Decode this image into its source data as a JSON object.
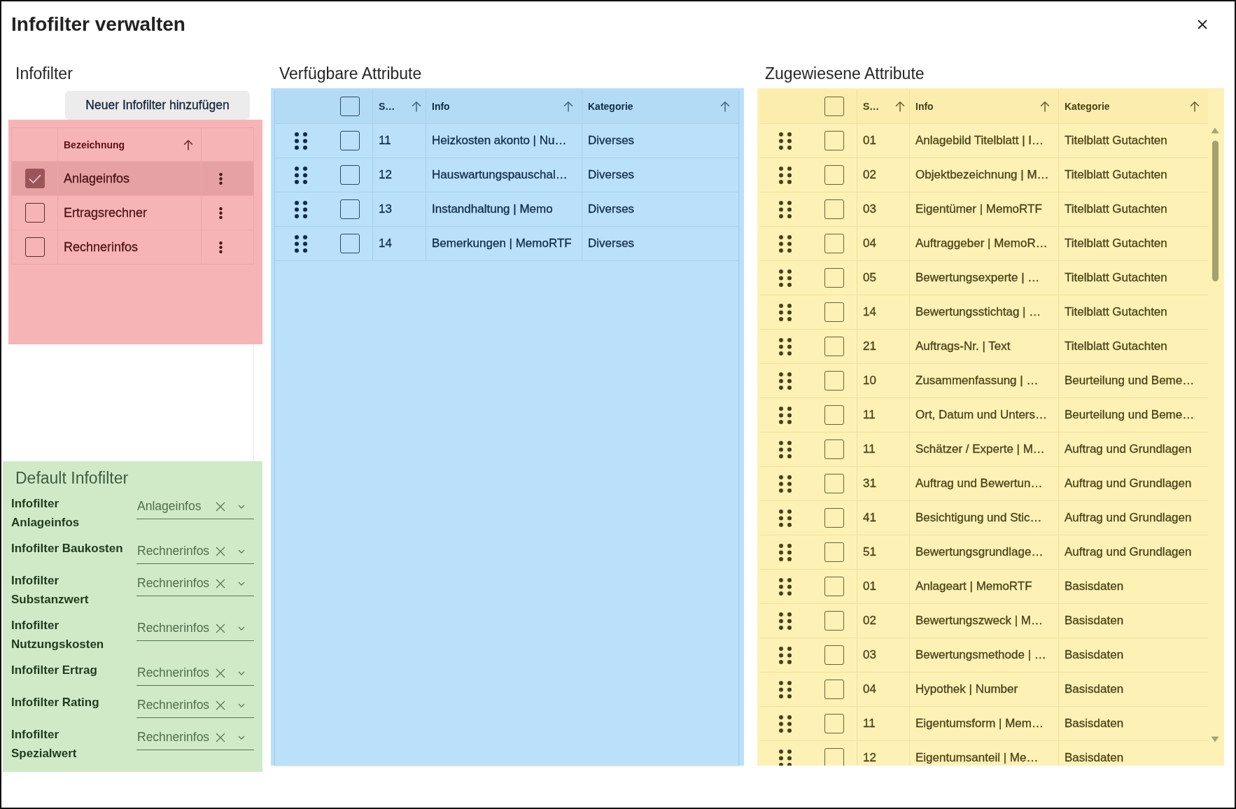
{
  "window": {
    "title": "Infofilter verwalten"
  },
  "infofilter": {
    "heading": "Infofilter",
    "add_button": "Neuer Infofilter hinzufügen",
    "columns": [
      {
        "label": "Bezeichnung",
        "sorted": true
      }
    ],
    "rows": [
      {
        "name": "Anlageinfos",
        "checked": true,
        "selected": true
      },
      {
        "name": "Ertragsrechner",
        "checked": false,
        "selected": false
      },
      {
        "name": "Rechnerinfos",
        "checked": false,
        "selected": false
      }
    ]
  },
  "default_infofilter": {
    "heading": "Default Infofilter",
    "fields": [
      {
        "label": "Infofilter Anlageinfos",
        "value": "Anlageinfos"
      },
      {
        "label": "Infofilter Baukosten",
        "value": "Rechnerinfos"
      },
      {
        "label": "Infofilter Substanzwert",
        "value": "Rechnerinfos"
      },
      {
        "label": "Infofilter Nutzungskosten",
        "value": "Rechnerinfos"
      },
      {
        "label": "Infofilter Ertrag",
        "value": "Rechnerinfos"
      },
      {
        "label": "Infofilter Rating",
        "value": "Rechnerinfos"
      },
      {
        "label": "Infofilter Spezialwert",
        "value": "Rechnerinfos"
      }
    ]
  },
  "available_attributes": {
    "heading": "Verfügbare Attribute",
    "header_checked": false,
    "columns": [
      {
        "label": "S…",
        "sorted": true
      },
      {
        "label": "Info",
        "sorted": true
      },
      {
        "label": "Kategorie",
        "sorted": true
      }
    ],
    "rows": [
      {
        "s": "11",
        "info": "Heizkosten akonto | Nu…",
        "kategorie": "Diverses",
        "checked": false
      },
      {
        "s": "12",
        "info": "Hauswartungspauschal…",
        "kategorie": "Diverses",
        "checked": false
      },
      {
        "s": "13",
        "info": "Instandhaltung | Memo",
        "kategorie": "Diverses",
        "checked": false
      },
      {
        "s": "14",
        "info": "Bemerkungen | MemoRTF",
        "kategorie": "Diverses",
        "checked": false
      }
    ]
  },
  "assigned_attributes": {
    "heading": "Zugewiesene Attribute",
    "header_checked": false,
    "columns": [
      {
        "label": "S…",
        "sorted": true
      },
      {
        "label": "Info",
        "sorted": true
      },
      {
        "label": "Kategorie",
        "sorted": true
      }
    ],
    "rows": [
      {
        "s": "01",
        "info": "Anlagebild Titelblatt | I…",
        "kategorie": "Titelblatt Gutachten",
        "checked": false
      },
      {
        "s": "02",
        "info": "Objektbezeichnung | M…",
        "kategorie": "Titelblatt Gutachten",
        "checked": false
      },
      {
        "s": "03",
        "info": "Eigentümer | MemoRTF",
        "kategorie": "Titelblatt Gutachten",
        "checked": false
      },
      {
        "s": "04",
        "info": "Auftraggeber | MemoR…",
        "kategorie": "Titelblatt Gutachten",
        "checked": false
      },
      {
        "s": "05",
        "info": "Bewertungsexperte | …",
        "kategorie": "Titelblatt Gutachten",
        "checked": false
      },
      {
        "s": "14",
        "info": "Bewertungsstichtag | …",
        "kategorie": "Titelblatt Gutachten",
        "checked": false
      },
      {
        "s": "21",
        "info": "Auftrags-Nr. | Text",
        "kategorie": "Titelblatt Gutachten",
        "checked": false
      },
      {
        "s": "10",
        "info": "Zusammenfassung | …",
        "kategorie": "Beurteilung und Beme…",
        "checked": false
      },
      {
        "s": "11",
        "info": "Ort, Datum und Unters…",
        "kategorie": "Beurteilung und Beme…",
        "checked": false
      },
      {
        "s": "11",
        "info": "Schätzer / Experte | M…",
        "kategorie": "Auftrag und Grundlagen",
        "checked": false
      },
      {
        "s": "31",
        "info": "Auftrag und Bewertun…",
        "kategorie": "Auftrag und Grundlagen",
        "checked": false
      },
      {
        "s": "41",
        "info": "Besichtigung und Stic…",
        "kategorie": "Auftrag und Grundlagen",
        "checked": false
      },
      {
        "s": "51",
        "info": "Bewertungsgrundlage…",
        "kategorie": "Auftrag und Grundlagen",
        "checked": false
      },
      {
        "s": "01",
        "info": "Anlageart | MemoRTF",
        "kategorie": "Basisdaten",
        "checked": false
      },
      {
        "s": "02",
        "info": "Bewertungszweck | M…",
        "kategorie": "Basisdaten",
        "checked": false
      },
      {
        "s": "03",
        "info": "Bewertungsmethode | …",
        "kategorie": "Basisdaten",
        "checked": false
      },
      {
        "s": "04",
        "info": "Hypothek | Number",
        "kategorie": "Basisdaten",
        "checked": false
      },
      {
        "s": "11",
        "info": "Eigentumsform | Mem…",
        "kategorie": "Basisdaten",
        "checked": false
      },
      {
        "s": "12",
        "info": "Eigentumsanteil | Me…",
        "kategorie": "Basisdaten",
        "checked": false
      }
    ]
  }
}
